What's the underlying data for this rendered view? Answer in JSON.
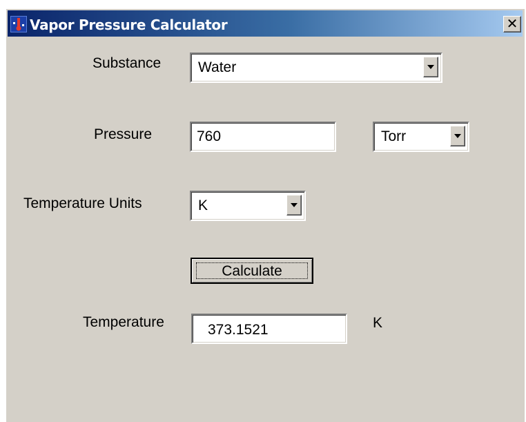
{
  "window": {
    "title": "Vapor Pressure Calculator",
    "close_glyph": "✕",
    "icon": "app-thermometer-icon",
    "titlebar_colors": [
      "#0a246a",
      "#a6caf0"
    ],
    "face_color": "#d4d0c8"
  },
  "substance": {
    "label": "Substance",
    "value": "Water"
  },
  "pressure": {
    "label": "Pressure",
    "value": "760",
    "unit": "Torr"
  },
  "temperature_units": {
    "label": "Temperature Units",
    "value": "K"
  },
  "calculate_button": {
    "label": "Calculate"
  },
  "result": {
    "label": "Temperature",
    "value": "373.1521",
    "unit": "K"
  }
}
